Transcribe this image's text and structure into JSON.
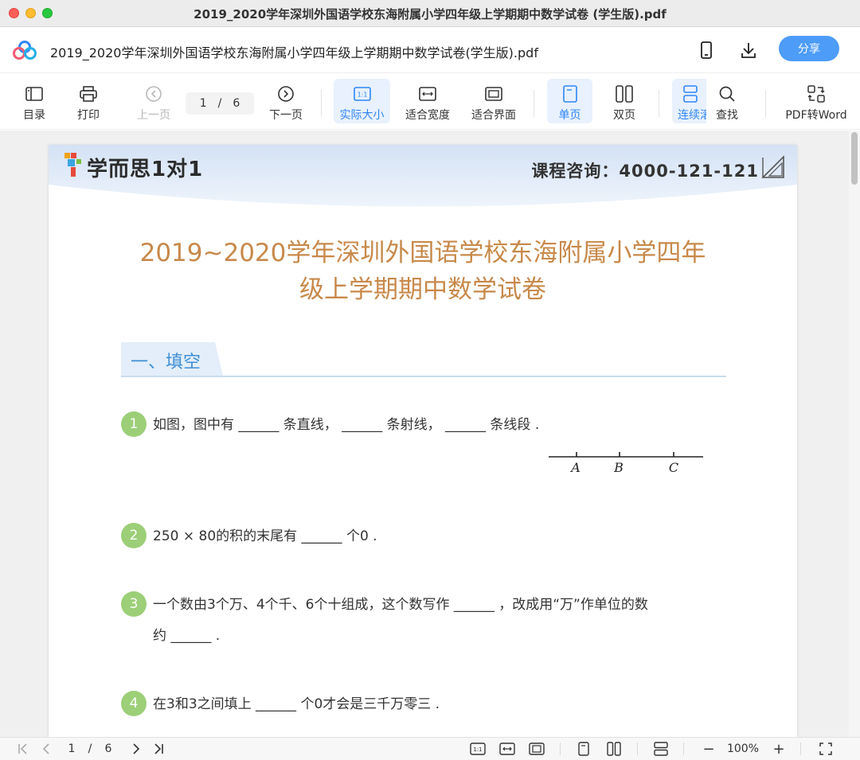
{
  "window": {
    "title": "2019_2020学年深圳外国语学校东海附属小学四年级上学期期中数学试卷 (学生版).pdf"
  },
  "header": {
    "doc_name": "2019_2020学年深圳外国语学校东海附属小学四年级上学期期中数学试卷(学生版).pdf",
    "share_label": "分享",
    "icons": [
      "phone-icon",
      "download-icon"
    ]
  },
  "toolbar": {
    "toc": "目录",
    "print": "打印",
    "prev": "上一页",
    "page_current": "1",
    "page_sep": "/",
    "page_total": "6",
    "next": "下一页",
    "actual_size": "实际大小",
    "fit_width": "适合宽度",
    "fit_page": "适合界面",
    "single": "单页",
    "double": "双页",
    "continuous": "连续滚",
    "find": "查找",
    "to_word": "PDF转Word",
    "accent": "#2f86f6"
  },
  "document": {
    "brand": "学而思1对1",
    "hotline": "课程咨询：4000-121-121",
    "title_line1": "2019~2020学年深圳外国语学校东海附属小学四年",
    "title_line2": "级上学期期中数学试卷",
    "section": "一、填空",
    "questions": [
      {
        "num": "1",
        "text": "如图，图中有 ______ 条直线， ______ 条射线， ______ 条线段 ."
      },
      {
        "num": "2",
        "text": "250 × 80的积的末尾有 ______ 个0 ."
      },
      {
        "num": "3",
        "text": "一个数由3个万、4个千、6个十组成，这个数写作 ______ ，改成用“万”作单位的数",
        "text2": "约 ______  ."
      },
      {
        "num": "4",
        "text": "在3和3之间填上 ______ 个0才会是三千万零三 ."
      }
    ],
    "figure_points": [
      "A",
      "B",
      "C"
    ]
  },
  "bottombar": {
    "page_current": "1",
    "page_sep": "/",
    "page_total": "6",
    "zoom": "100%",
    "minus": "−",
    "plus": "+"
  }
}
